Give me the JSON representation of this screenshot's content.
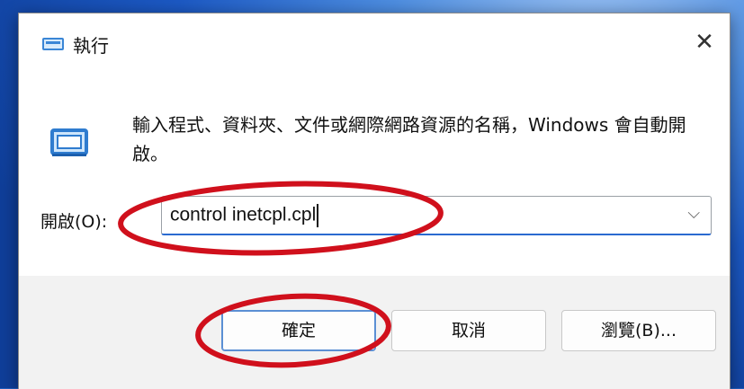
{
  "dialog": {
    "title": "執行",
    "close_glyph": "✕",
    "description": "輸入程式、資料夾、文件或網際網路資源的名稱，Windows 會自動開啟。",
    "open_label": "開啟(O):",
    "command_value": "control inetcpl.cpl",
    "dropdown_glyph": "⌵",
    "buttons": {
      "ok": "確定",
      "cancel": "取消",
      "browse": "瀏覽(B)..."
    }
  },
  "icons": {
    "title_icon": "run-icon",
    "main_icon": "run-icon",
    "accent": "#3a86d6"
  },
  "annotation_color": "#d0101c"
}
